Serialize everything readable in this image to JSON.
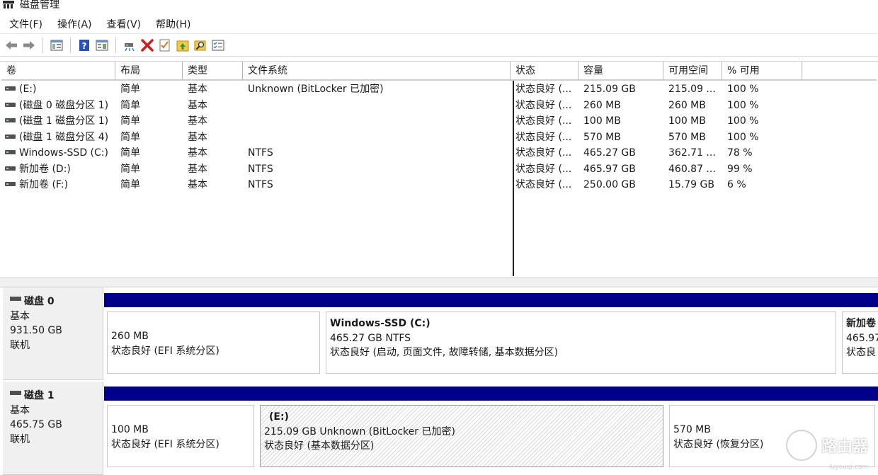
{
  "window": {
    "title": "磁盘管理"
  },
  "menu": [
    "文件(F)",
    "操作(A)",
    "查看(V)",
    "帮助(H)"
  ],
  "toolbar": {
    "icons": [
      "back-arrow-icon",
      "forward-arrow-icon",
      "console-tree-icon",
      "help-icon",
      "properties-panel-icon",
      "connect-disk-icon",
      "delete-icon",
      "check-icon",
      "folder-up-icon",
      "search-folder-icon",
      "checklist-icon"
    ],
    "accent_delete": "#d11a1a"
  },
  "volume_list": {
    "columns": [
      "卷",
      "布局",
      "类型",
      "文件系统",
      "状态",
      "容量",
      "可用空间",
      "% 可用"
    ],
    "rows": [
      [
        "(E:)",
        "简单",
        "基本",
        "Unknown (BitLocker 已加密)",
        "状态良好 (...",
        "215.09 GB",
        "215.09 ...",
        "100 %"
      ],
      [
        "(磁盘 0 磁盘分区 1)",
        "简单",
        "基本",
        "",
        "状态良好 (...",
        "260 MB",
        "260 MB",
        "100 %"
      ],
      [
        "(磁盘 1 磁盘分区 1)",
        "简单",
        "基本",
        "",
        "状态良好 (...",
        "100 MB",
        "100 MB",
        "100 %"
      ],
      [
        "(磁盘 1 磁盘分区 4)",
        "简单",
        "基本",
        "",
        "状态良好 (...",
        "570 MB",
        "570 MB",
        "100 %"
      ],
      [
        "Windows-SSD (C:)",
        "简单",
        "基本",
        "NTFS",
        "状态良好 (...",
        "465.27 GB",
        "362.71 ...",
        "78 %"
      ],
      [
        "新加卷 (D:)",
        "简单",
        "基本",
        "NTFS",
        "状态良好 (...",
        "465.97 GB",
        "460.87 ...",
        "99 %"
      ],
      [
        "新加卷 (F:)",
        "简单",
        "基本",
        "NTFS",
        "状态良好 (...",
        "250.00 GB",
        "15.79 GB",
        "6 %"
      ]
    ]
  },
  "disks": [
    {
      "name": "磁盘 0",
      "type": "基本",
      "size": "931.50 GB",
      "status": "联机",
      "partitions": [
        {
          "title": "",
          "line1": "260 MB",
          "line2": "状态良好 (EFI 系统分区)"
        },
        {
          "title": "Windows-SSD  (C:)",
          "line1": "465.27 GB NTFS",
          "line2": "状态良好 (启动, 页面文件, 故障转储, 基本数据分区)"
        },
        {
          "title": "新加卷",
          "line1": "465.97",
          "line2": "状态良"
        }
      ]
    },
    {
      "name": "磁盘 1",
      "type": "基本",
      "size": "465.75 GB",
      "status": "联机",
      "partitions": [
        {
          "title": "",
          "line1": "100 MB",
          "line2": "状态良好 (EFI 系统分区)"
        },
        {
          "title": "(E:)",
          "line1": "215.09 GB Unknown (BitLocker 已加密)",
          "line2": "状态良好 (基本数据分区)"
        },
        {
          "title": "",
          "line1": "570 MB",
          "line2": "状态良好 (恢复分区)"
        }
      ]
    }
  ],
  "watermark": {
    "text": "路由器",
    "sub": "luyouqi.com"
  },
  "colors": {
    "partition_bar": "#00008b",
    "panel_bg": "#f0f0f0"
  }
}
